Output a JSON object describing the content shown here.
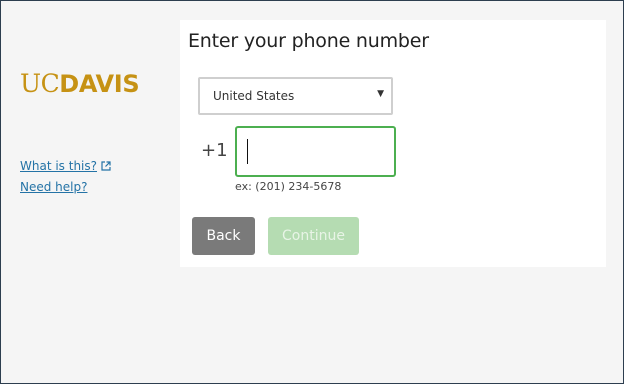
{
  "brand": {
    "uc": "UC",
    "davis": "DAVIS",
    "color": "#c69214"
  },
  "sidebar": {
    "what_is_this": "What is this?",
    "need_help": "Need help?"
  },
  "form": {
    "title": "Enter your phone number",
    "country": {
      "selected": "United States"
    },
    "phone": {
      "prefix": "+1",
      "value": "",
      "hint": "ex: (201) 234-5678"
    },
    "buttons": {
      "back": "Back",
      "continue": "Continue"
    }
  },
  "colors": {
    "link": "#2473a6",
    "input_focus": "#4caf50",
    "back_button": "#7a7a7a",
    "continue_disabled": "#b5dcb2"
  }
}
